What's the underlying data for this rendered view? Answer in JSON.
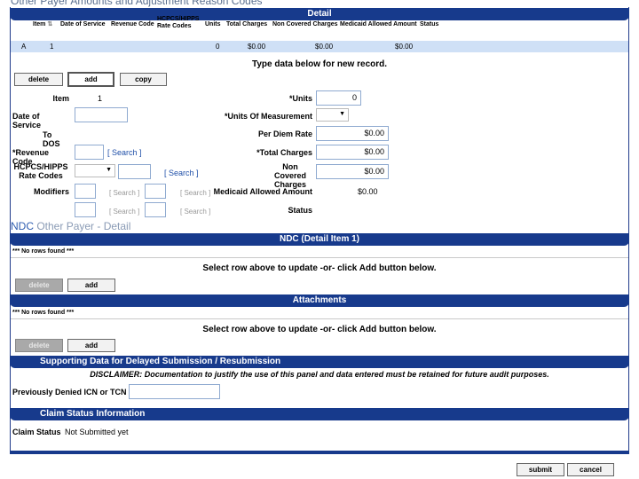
{
  "top_link": "Other Payer Amounts and Adjustment Reason Codes",
  "detail": {
    "title": "Detail",
    "columns": [
      "Item",
      "Date of Service",
      "Revenue Code",
      "HCPCS/HIPPS Rate Codes",
      "Units",
      "Total Charges",
      "Non Covered Charges",
      "Medicaid Allowed Amount",
      "Status"
    ],
    "row": {
      "sel": "A",
      "item": "1",
      "units": "0",
      "total": "$0.00",
      "noncovered": "$0.00",
      "allowed": "$0.00"
    },
    "instruction": "Type data below for new record.",
    "buttons": {
      "delete": "delete",
      "add": "add",
      "copy": "copy"
    }
  },
  "form": {
    "item_label": "Item",
    "item_value": "1",
    "dos_label": "Date of Service",
    "todos_label": "To DOS",
    "revenue_label": "*Revenue Code",
    "search": "[ Search ]",
    "hcpcs_label_1": "HCPCS/HIPPS",
    "hcpcs_label_2": "Rate Codes",
    "modifiers_label": "Modifiers",
    "units_label": "*Units",
    "units_value": "0",
    "uom_label": "*Units Of Measurement",
    "perdiem_label": "Per Diem Rate",
    "perdiem_value": "$0.00",
    "total_label": "*Total Charges",
    "total_value": "$0.00",
    "noncov_label_1": "Non Covered",
    "noncov_label_2": "Charges",
    "noncov_value": "$0.00",
    "allowed_label": "Medicaid Allowed Amount",
    "allowed_value": "$0.00",
    "status_label": "Status"
  },
  "subnav": {
    "ndc": "NDC",
    "other": "Other Payer - Detail"
  },
  "ndc": {
    "title": "NDC (Detail Item 1)",
    "norows": "*** No rows found ***",
    "instruction": "Select row above to update -or- click Add button below.",
    "delete": "delete",
    "add": "add"
  },
  "attachments": {
    "title": "Attachments",
    "norows": "*** No rows found ***",
    "instruction": "Select row above to update -or- click Add button below.",
    "delete": "delete",
    "add": "add"
  },
  "supporting": {
    "title": "Supporting Data for Delayed Submission / Resubmission",
    "disclaimer": "DISCLAIMER: Documentation to justify the use of this panel and data entered must be retained for future audit purposes.",
    "icn_label": "Previously Denied ICN or TCN"
  },
  "claim_status": {
    "title": "Claim Status Information",
    "label": "Claim Status",
    "value": "Not Submitted yet"
  },
  "footer": {
    "submit": "submit",
    "cancel": "cancel"
  }
}
